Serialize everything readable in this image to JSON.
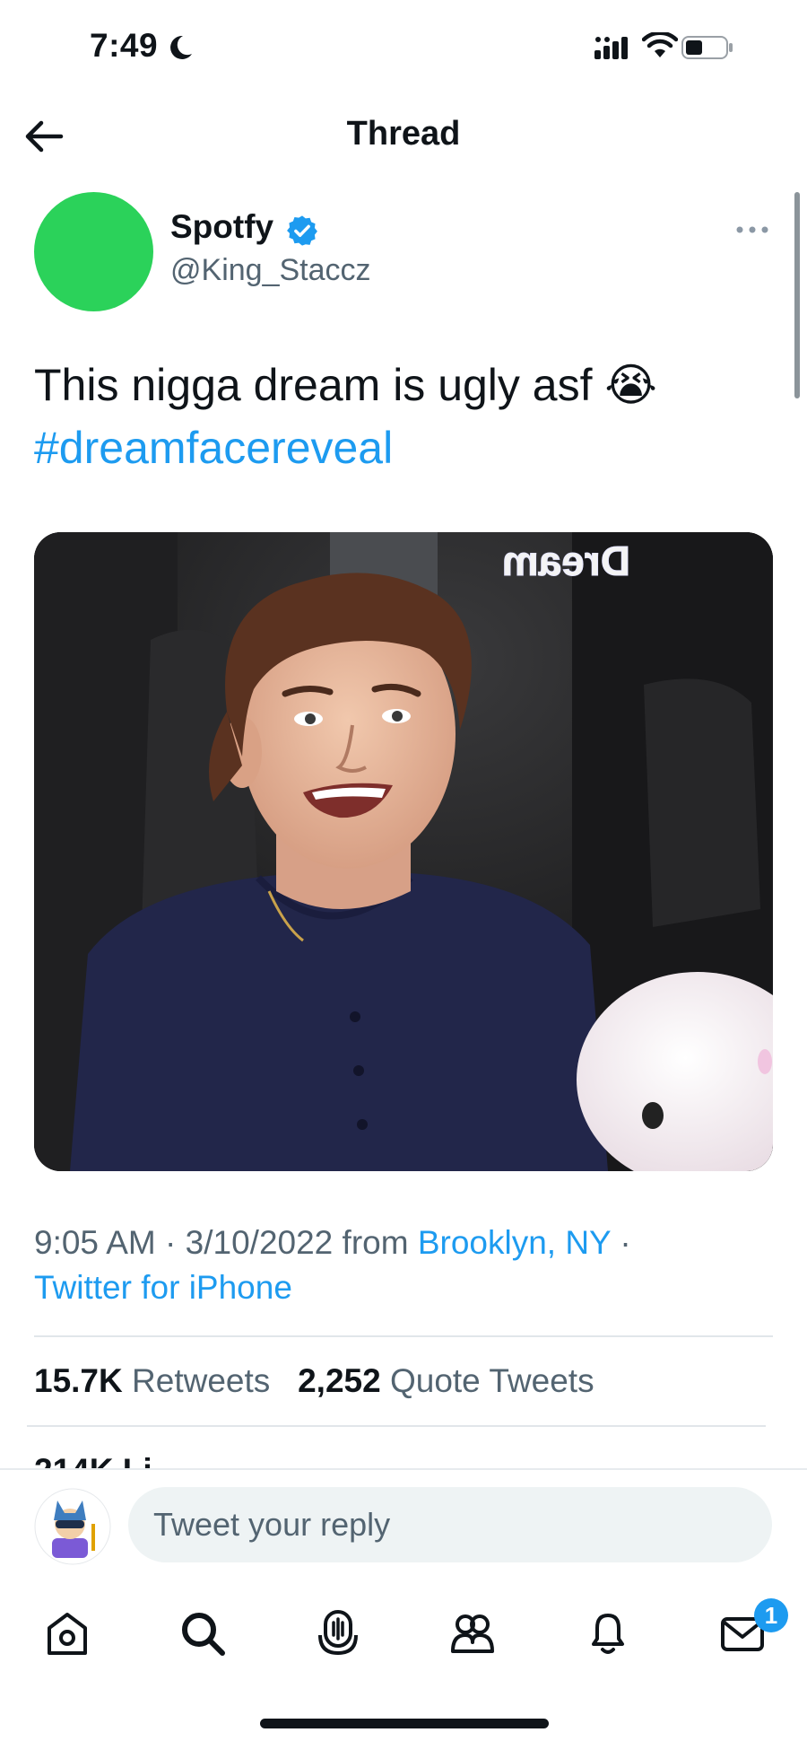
{
  "status_bar": {
    "time": "7:49",
    "icons": [
      "moon-icon",
      "cellular-icon",
      "wifi-icon",
      "battery-icon"
    ]
  },
  "header": {
    "title": "Thread",
    "back_icon": "arrow-left-icon"
  },
  "tweet": {
    "author_name": "Spotfy",
    "author_handle": "@King_Staccz",
    "avatar_color": "#2bd25a",
    "verified": true,
    "text": "This nigga dream is ugly asf 😭",
    "hashtag": "#dreamfacereveal",
    "media_sign_text": "Dream",
    "time": "9:05 AM",
    "date": "3/10/2022",
    "from_label": "from",
    "location": "Brooklyn, NY",
    "source": "Twitter for iPhone",
    "retweets_count": "15.7K",
    "retweets_label": "Retweets",
    "quotes_count": "2,252",
    "quotes_label": "Quote Tweets",
    "likes_partial": "214K Li"
  },
  "reply": {
    "placeholder": "Tweet your reply"
  },
  "tab_bar": {
    "items": [
      "home-icon",
      "search-icon",
      "spaces-icon",
      "communities-icon",
      "notifications-icon",
      "messages-icon"
    ],
    "messages_badge": "1"
  },
  "colors": {
    "accent": "#1d9bf0",
    "text": "#0f1419",
    "secondary": "#536471"
  }
}
